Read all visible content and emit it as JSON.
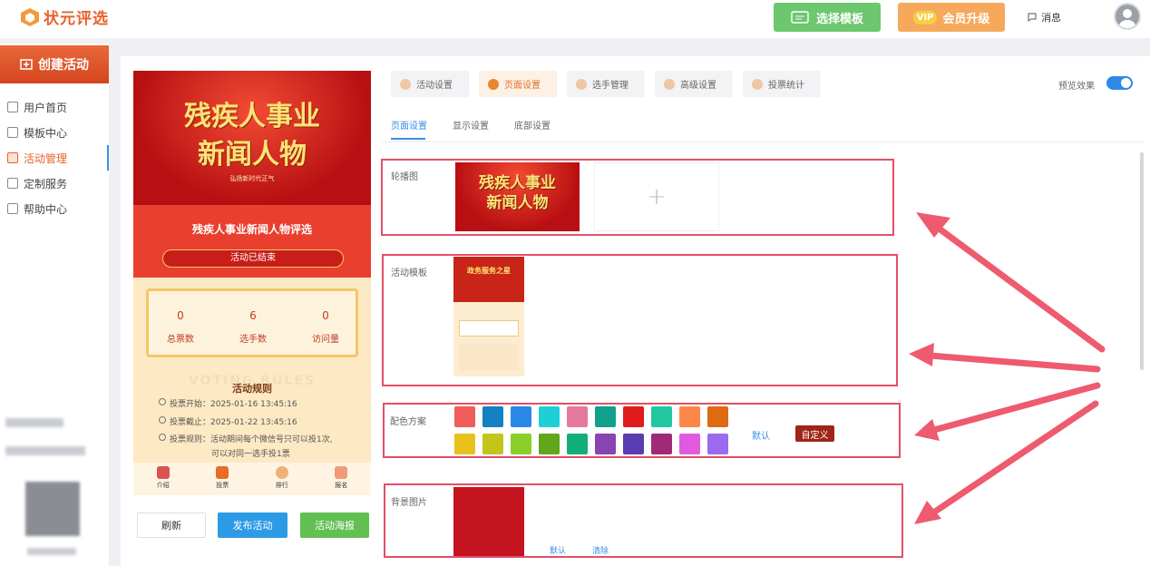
{
  "brand": {
    "name": "状元评选"
  },
  "header": {
    "template_button": "选择模板",
    "vip_badge": "VIP",
    "vip_button": "会员升级",
    "messages": "消息"
  },
  "sidebar": {
    "create_button": "创建活动",
    "items": [
      {
        "label": "用户首页",
        "icon": "home-icon"
      },
      {
        "label": "模板中心",
        "icon": "template-icon"
      },
      {
        "label": "活动管理",
        "icon": "activity-icon",
        "active": true
      },
      {
        "label": "定制服务",
        "icon": "custom-icon"
      },
      {
        "label": "帮助中心",
        "icon": "help-icon"
      }
    ]
  },
  "preview": {
    "banner_title_line1": "残疾人事业",
    "banner_title_line2": "新闻人物",
    "banner_subtitle": "弘扬新时代正气",
    "event_title": "残疾人事业新闻人物评选",
    "status": "活动已结束",
    "stats": [
      {
        "value": "0",
        "label": "总票数"
      },
      {
        "value": "6",
        "label": "选手数"
      },
      {
        "value": "0",
        "label": "访问量"
      }
    ],
    "rules_watermark": "VOTING RULES",
    "rules_title": "活动规则",
    "rules": [
      "投票开始：2025-01-16 13:45:16",
      "投票截止：2025-01-22 13:45:16",
      "投票规则：活动期间每个微信号只可以投1次,",
      "可以对同一选手投1票"
    ],
    "tabbar": [
      "介绍",
      "投票",
      "排行",
      "报名"
    ],
    "buttons": {
      "refresh": "刷新",
      "publish": "发布活动",
      "poster": "活动海报"
    }
  },
  "settings": {
    "tabs": [
      "活动设置",
      "页面设置",
      "选手管理",
      "高级设置",
      "投票统计"
    ],
    "active_tab": "页面设置",
    "preview_label": "预览效果",
    "preview_enabled": true,
    "subtabs": [
      "页面设置",
      "显示设置",
      "底部设置"
    ],
    "active_subtab": "页面设置",
    "carousel_label": "轮播图",
    "carousel_image_line1": "残疾人事业",
    "carousel_image_line2": "新闻人物",
    "template_label": "活动模板",
    "template_thumb_title": "政务服务之星",
    "color_label": "配色方案",
    "colors": [
      "#f05c5c",
      "#1481c2",
      "#2a88e8",
      "#1ed0d6",
      "#e47aa0",
      "#11a08a",
      "#e01b1b",
      "#22c7a0",
      "#fb8848",
      "#e06a12",
      "#e8c21b",
      "#c4c51b",
      "#8ccf2a",
      "#62a61c",
      "#12ae7a",
      "#8a44b0",
      "#5a3db0",
      "#a02a78",
      "#e05ae0",
      "#9a6bf0"
    ],
    "color_default": "默认",
    "color_custom": "自定义",
    "bg_label": "背景图片",
    "bg_default": "默认",
    "bg_clear": "清除"
  }
}
